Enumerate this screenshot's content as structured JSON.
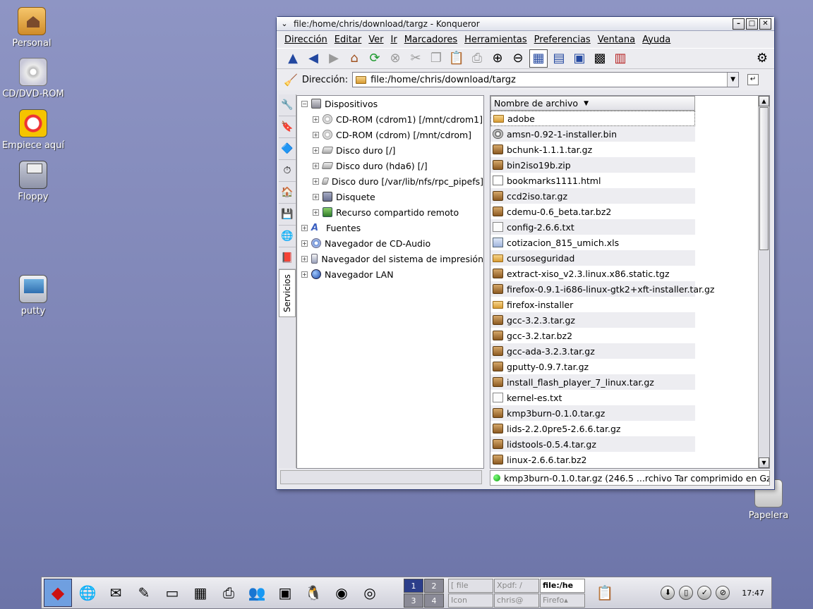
{
  "desktop": {
    "icons": [
      {
        "label": "Personal",
        "icon": "home-folder-icon"
      },
      {
        "label": "CD/DVD-ROM",
        "icon": "cd-icon"
      },
      {
        "label": "Empiece aquí",
        "icon": "start-here-icon"
      },
      {
        "label": "Floppy",
        "icon": "floppy-icon"
      },
      {
        "label": "putty",
        "icon": "terminal-icon"
      },
      {
        "label": "Papelera",
        "icon": "trash-icon"
      }
    ]
  },
  "window": {
    "title": "file:/home/chris/download/targz - Konqueror",
    "menu_glyph": "⌄",
    "buttons": {
      "minimize": "–",
      "maximize": "□",
      "close": "✕"
    }
  },
  "menubar": [
    "Dirección",
    "Editar",
    "Ver",
    "Ir",
    "Marcadores",
    "Herramientas",
    "Preferencias",
    "Ventana",
    "Ayuda"
  ],
  "toolbar": {
    "items": [
      {
        "name": "up-icon",
        "glyph": "▲",
        "cls": "tb-blue"
      },
      {
        "name": "back-icon",
        "glyph": "◀",
        "cls": "tb-blue"
      },
      {
        "name": "forward-icon",
        "glyph": "▶",
        "cls": "tb-grey"
      },
      {
        "name": "home-icon",
        "glyph": "⌂",
        "cls": "tb-house"
      },
      {
        "name": "reload-icon",
        "glyph": "⟳",
        "cls": "tb-green"
      },
      {
        "name": "stop-icon",
        "glyph": "⊗",
        "cls": "tb-grey"
      },
      {
        "name": "cut-icon",
        "glyph": "✂",
        "cls": "tb-grey"
      },
      {
        "name": "copy-icon",
        "glyph": "❐",
        "cls": "tb-grey"
      },
      {
        "name": "paste-icon",
        "glyph": "📋",
        "cls": ""
      },
      {
        "name": "print-icon",
        "glyph": "⎙",
        "cls": "tb-grey"
      },
      {
        "name": "zoom-in-icon",
        "glyph": "⊕",
        "cls": ""
      },
      {
        "name": "zoom-out-icon",
        "glyph": "⊖",
        "cls": ""
      },
      {
        "name": "icon-view-icon",
        "glyph": "▦",
        "cls": "tb-blue"
      },
      {
        "name": "tree-view-icon",
        "glyph": "▤",
        "cls": "tb-blue"
      },
      {
        "name": "preview-icon",
        "glyph": "▣",
        "cls": "tb-blue"
      },
      {
        "name": "multicolumn-view-icon",
        "glyph": "▩",
        "cls": ""
      },
      {
        "name": "tile-view-icon",
        "glyph": "▥",
        "cls": "tb-red"
      }
    ],
    "throbber_glyph": "⚙"
  },
  "addressbar": {
    "label": "Dirección:",
    "value": "file:/home/chris/download/targz"
  },
  "sidebar": {
    "tabs": [
      "🔧",
      "🔖",
      "🔷",
      "⏱",
      "🏠",
      "💾",
      "🌐",
      "📕"
    ],
    "services_label": "Servicios"
  },
  "tree": {
    "items": [
      {
        "label": "Dispositivos",
        "level": 0,
        "expander": "−",
        "icon": "ti-devs",
        "name": "devices-icon"
      },
      {
        "label": "CD-ROM (cdrom1) [/mnt/cdrom1]",
        "level": 1,
        "expander": "+",
        "icon": "ti-cd",
        "name": "cdrom-icon"
      },
      {
        "label": "CD-ROM (cdrom) [/mnt/cdrom]",
        "level": 1,
        "expander": "+",
        "icon": "ti-cd",
        "name": "cdrom-icon"
      },
      {
        "label": "Disco duro  [/]",
        "level": 1,
        "expander": "+",
        "icon": "ti-disk",
        "name": "hard-disk-icon"
      },
      {
        "label": "Disco duro (hda6) [/]",
        "level": 1,
        "expander": "+",
        "icon": "ti-disk",
        "name": "hard-disk-icon"
      },
      {
        "label": "Disco duro  [/var/lib/nfs/rpc_pipefs]",
        "level": 1,
        "expander": "+",
        "icon": "ti-disk",
        "name": "hard-disk-icon"
      },
      {
        "label": "Disquete",
        "level": 1,
        "expander": "+",
        "icon": "ti-floppy",
        "name": "floppy-icon"
      },
      {
        "label": "Recurso compartido remoto",
        "level": 1,
        "expander": "+",
        "icon": "ti-net",
        "name": "network-share-icon"
      },
      {
        "label": "Fuentes",
        "level": 0,
        "expander": "+",
        "icon": "ti-font",
        "name": "fonts-icon"
      },
      {
        "label": "Navegador de CD-Audio",
        "level": 0,
        "expander": "+",
        "icon": "ti-audio",
        "name": "audio-cd-icon"
      },
      {
        "label": "Navegador del sistema de impresión",
        "level": 0,
        "expander": "+",
        "icon": "ti-print",
        "name": "printer-icon"
      },
      {
        "label": "Navegador LAN",
        "level": 0,
        "expander": "+",
        "icon": "ti-lan",
        "name": "lan-icon"
      }
    ]
  },
  "filelist": {
    "column_header": "Nombre de archivo",
    "sort_glyph": "▼",
    "files": [
      {
        "name": "adobe",
        "type": "folder"
      },
      {
        "name": "amsn-0.92-1-installer.bin",
        "type": "bin"
      },
      {
        "name": "bchunk-1.1.1.tar.gz",
        "type": "archive"
      },
      {
        "name": "bin2iso19b.zip",
        "type": "archive"
      },
      {
        "name": "bookmarks1111.html",
        "type": "html"
      },
      {
        "name": "ccd2iso.tar.gz",
        "type": "archive"
      },
      {
        "name": "cdemu-0.6_beta.tar.bz2",
        "type": "archive"
      },
      {
        "name": "config-2.6.6.txt",
        "type": "text"
      },
      {
        "name": "cotizacion_815_umich.xls",
        "type": "xls"
      },
      {
        "name": "cursoseguridad",
        "type": "folder"
      },
      {
        "name": "extract-xiso_v2.3.linux.x86.static.tgz",
        "type": "archive"
      },
      {
        "name": "firefox-0.9.1-i686-linux-gtk2+xft-installer.tar.gz",
        "type": "archive"
      },
      {
        "name": "firefox-installer",
        "type": "folder"
      },
      {
        "name": "gcc-3.2.3.tar.gz",
        "type": "archive"
      },
      {
        "name": "gcc-3.2.tar.bz2",
        "type": "archive"
      },
      {
        "name": "gcc-ada-3.2.3.tar.gz",
        "type": "archive"
      },
      {
        "name": "gputty-0.9.7.tar.gz",
        "type": "archive"
      },
      {
        "name": "install_flash_player_7_linux.tar.gz",
        "type": "archive"
      },
      {
        "name": "kernel-es.txt",
        "type": "text"
      },
      {
        "name": "kmp3burn-0.1.0.tar.gz",
        "type": "archive"
      },
      {
        "name": "lids-2.2.0pre5-2.6.6.tar.gz",
        "type": "archive"
      },
      {
        "name": "lidstools-0.5.4.tar.gz",
        "type": "archive"
      },
      {
        "name": "linux-2.6.6.tar.bz2",
        "type": "archive"
      }
    ]
  },
  "scrollbar": {
    "up": "▲",
    "down": "▼"
  },
  "statusbar": {
    "text": "kmp3burn-0.1.0.tar.gz (246.5 ...rchivo Tar comprimido en Gzip"
  },
  "taskbar": {
    "launchers": [
      {
        "name": "redhat-menu-icon",
        "glyph": "◆"
      },
      {
        "name": "web-browser-icon",
        "glyph": "🌐"
      },
      {
        "name": "email-icon",
        "glyph": "✉"
      },
      {
        "name": "writer-icon",
        "glyph": "✎"
      },
      {
        "name": "presentation-icon",
        "glyph": "▭"
      },
      {
        "name": "spreadsheet-icon",
        "glyph": "▦"
      },
      {
        "name": "printer-icon",
        "glyph": "⎙"
      },
      {
        "name": "messenger-icon",
        "glyph": "👥"
      },
      {
        "name": "terminal-icon",
        "glyph": "▣"
      },
      {
        "name": "linux-tux-icon",
        "glyph": "🐧"
      },
      {
        "name": "thunderbird-icon",
        "glyph": "◉"
      },
      {
        "name": "firefox-icon",
        "glyph": "◎"
      }
    ],
    "pager": [
      {
        "label": "1",
        "active": true
      },
      {
        "label": "2",
        "active": false
      },
      {
        "label": "3",
        "active": false
      },
      {
        "label": "4",
        "active": false
      }
    ],
    "tasks": [
      {
        "label": "[ file",
        "active": false
      },
      {
        "label": "Xpdf: /",
        "active": false
      },
      {
        "label": "file:/he",
        "active": true
      },
      {
        "label": "Icon",
        "active": false
      },
      {
        "label": "chris@",
        "active": false
      },
      {
        "label": "Firefo▴",
        "active": false
      }
    ],
    "clipboard_glyph": "📋",
    "tray": [
      "⬇",
      "▯",
      "✓",
      "⊘"
    ],
    "clock": "17:47"
  }
}
